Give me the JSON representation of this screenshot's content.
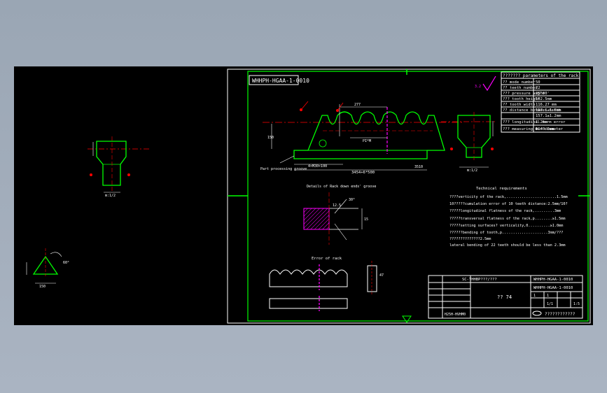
{
  "drawing": {
    "title_code": "WHHPH-HGAA-1-0010",
    "param_table": {
      "title": "??????? parameters of the rack",
      "rows": [
        [
          "?? mode number",
          "50"
        ],
        [
          "?? teeth number",
          "22"
        ],
        [
          "??? pressure angle",
          "25°00'"
        ],
        [
          "??? tooth height",
          "102.5mm"
        ],
        [
          "?? tooth width",
          "116.27 mm"
        ],
        [
          "?? distance between teeth",
          "157.1±1.5mm"
        ],
        [
          "",
          "157.1±1.2mm"
        ],
        [
          "??? longitudinal form error",
          "1.2mm"
        ],
        [
          "??? measuring bar diameter",
          "Φ140.0mm"
        ]
      ]
    },
    "notes": {
      "title": "Technical requirements",
      "lines": [
        "????verticity of the rack,.......................1.5mm",
        "10?????cumulation error of 10 teeth distance:2.5mm/10?",
        "?????longitudinal flatness of the rack,.........3mm",
        "?????transversal flatness of the rack,p........≥1.5mm",
        "?????setting surfaces? verticality,0..........≥1.0mm",
        "??????bending of tooth,p.....................3mm/???",
        "??????????????2.5mm",
        "lateral bending of 22 teeth should be less than 2.3mm"
      ]
    },
    "labels": {
      "detail_caption": "Details of Rack down ends' groove",
      "part_label": "Part processing groove",
      "rack_caption": "Error of rack",
      "dims_mid": "4×M30×100",
      "roughness": "3.2",
      "section_a": "m:1/2",
      "section_b": "m:1/2",
      "tooth_dim": "277",
      "pitch_dim": "PI*M",
      "tri_dim": "60°",
      "rack_len": "3454+6*500",
      "end_dim": "3510",
      "slot_dim": "150",
      "dim_30": "30°",
      "dim_a": "15",
      "dim_b": "12.5",
      "dim_c": "47"
    },
    "title_block": {
      "center_text": "?? 74",
      "right_code_1": "WHHPH-HGAA-1-0010",
      "right_code_2": "WHHPH-HGAA-1-0010",
      "head_label": "SC-THHBP???/???",
      "company": "????????????",
      "bottom_left": "H25H-HVHM0",
      "scale_row": [
        "1",
        "1",
        "",
        "1:5"
      ],
      "sheet": "1/1"
    }
  }
}
